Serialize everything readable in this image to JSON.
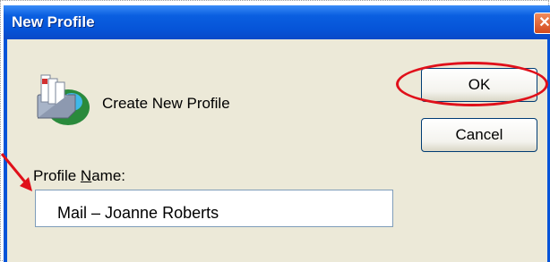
{
  "window": {
    "title": "New Profile",
    "close_symbol": "✕"
  },
  "main": {
    "message": "Create New Profile",
    "profile_name_label_pre": "Profile ",
    "profile_name_label_mnemonic": "N",
    "profile_name_label_post": "ame:",
    "profile_name_value": "Mail – Joanne Roberts"
  },
  "buttons": {
    "ok_label": "OK",
    "cancel_label": "Cancel"
  },
  "annotations": {
    "highlight_color": "#e0101a"
  },
  "icons": {
    "app_icon": "mail-profile-icon"
  }
}
